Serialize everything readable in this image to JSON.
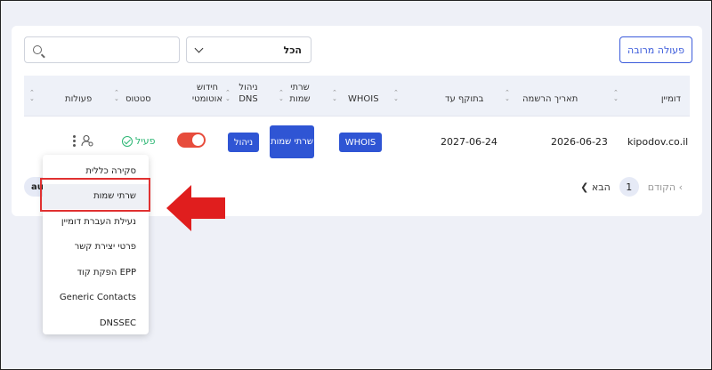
{
  "toolbar": {
    "bulk_action": "פעולה מרובה",
    "filter_value": "הכל",
    "search_placeholder": ""
  },
  "table": {
    "headers": {
      "domain": "דומיין",
      "reg_date": "תאריך הרשמה",
      "valid_until": "בתוקף עד",
      "whois": "WHOIS",
      "name_servers": "שרתי שמות",
      "dns_mgmt": "ניהול DNS",
      "auto_renew": "חידוש אוטומטי",
      "status": "סטטוס",
      "actions": "פעולות"
    },
    "row": {
      "domain": "kipodov.co.il",
      "reg_date": "2026-06-23",
      "valid_until": "2027-06-24",
      "whois_btn": "WHOIS",
      "ns_btn": "שרתי שמות",
      "dns_btn": "ניהול",
      "auto_renew": true,
      "status": "פעיל"
    }
  },
  "pagination": {
    "prev": "הקודם",
    "page": "1",
    "next": "הבא"
  },
  "tag": "au",
  "menu": {
    "items": [
      "סקירה כללית",
      "שרתי שמות",
      "נעילת העברת דומיין",
      "פרטי יצירת קשר",
      "הפקת קוד EPP",
      "Generic Contacts",
      "DNSSEC"
    ]
  },
  "colors": {
    "accent": "#2f55d4",
    "status_ok": "#2bb673",
    "highlight": "#e03131"
  }
}
